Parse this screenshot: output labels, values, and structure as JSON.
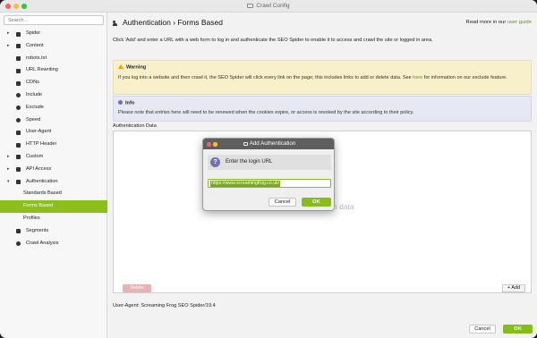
{
  "window": {
    "title": "Crawl Config"
  },
  "sidebar": {
    "search_placeholder": "Search...",
    "items": [
      {
        "label": "Spider",
        "icon": "gear-icon",
        "expand": "collapsed"
      },
      {
        "label": "Content",
        "icon": "document-icon",
        "expand": "collapsed"
      },
      {
        "label": "robots.txt",
        "icon": "robot-icon",
        "expand": "none"
      },
      {
        "label": "URL Rewriting",
        "icon": "edit-icon",
        "expand": "none"
      },
      {
        "label": "CDNs",
        "icon": "network-icon",
        "expand": "none"
      },
      {
        "label": "Include",
        "icon": "plus-circle-icon",
        "expand": "none"
      },
      {
        "label": "Exclude",
        "icon": "minus-circle-icon",
        "expand": "none"
      },
      {
        "label": "Speed",
        "icon": "speedometer-icon",
        "expand": "none"
      },
      {
        "label": "User-Agent",
        "icon": "user-icon",
        "expand": "none"
      },
      {
        "label": "HTTP Header",
        "icon": "header-icon",
        "expand": "none"
      },
      {
        "label": "Custom",
        "icon": "wrench-icon",
        "expand": "collapsed"
      },
      {
        "label": "API Access",
        "icon": "api-icon",
        "expand": "collapsed"
      },
      {
        "label": "Authentication",
        "icon": "users-icon",
        "expand": "expanded"
      },
      {
        "label": "Standards Based",
        "icon": "",
        "expand": "child"
      },
      {
        "label": "Forms Based",
        "icon": "",
        "expand": "child-selected"
      },
      {
        "label": "Profiles",
        "icon": "",
        "expand": "child"
      },
      {
        "label": "Segments",
        "icon": "segments-icon",
        "expand": "none"
      },
      {
        "label": "Crawl Analysis",
        "icon": "magnifier-icon",
        "expand": "none"
      }
    ]
  },
  "main": {
    "heading_section": "Authentication",
    "heading_sep": " › ",
    "heading_page": "Forms Based",
    "readmore_prefix": "Read more in our ",
    "readmore_link": "user guide",
    "intro": "Click 'Add' and enter a URL with a web form to log in and authenticate the SEO Spider to enable it to access and crawl the site or logged in area.",
    "warning": {
      "title": "Warning",
      "body_part1": "If you log into a website and then crawl it, the SEO Spider will click every link on the page; this includes links to add or delete data. See ",
      "body_link": "here",
      "body_part2": " for information on our exclude feature."
    },
    "info": {
      "title": "Info",
      "body": "Please note that entries here will need to be renewed when the cookies expire, or access is revoked by the site according to their policy."
    },
    "auth_data_label": "Authentication Data",
    "no_data": "n data",
    "delete_label": "Delete",
    "add_label": "+ Add",
    "user_agent": "User-Agent: Screaming Frog SEO Spider/19.4",
    "cancel_label": "Cancel",
    "ok_label": "OK"
  },
  "modal": {
    "title": "Add Authentication",
    "prompt": "Enter the login URL",
    "url_value": "https://www.screamingfrog.co.uk/",
    "cancel_label": "Cancel",
    "ok_label": "OK"
  },
  "colors": {
    "accent_green": "#87bd19",
    "warning_bg": "#f8efcb",
    "info_bg": "#e6e8f4",
    "selected_row": "#8cbf1a"
  }
}
